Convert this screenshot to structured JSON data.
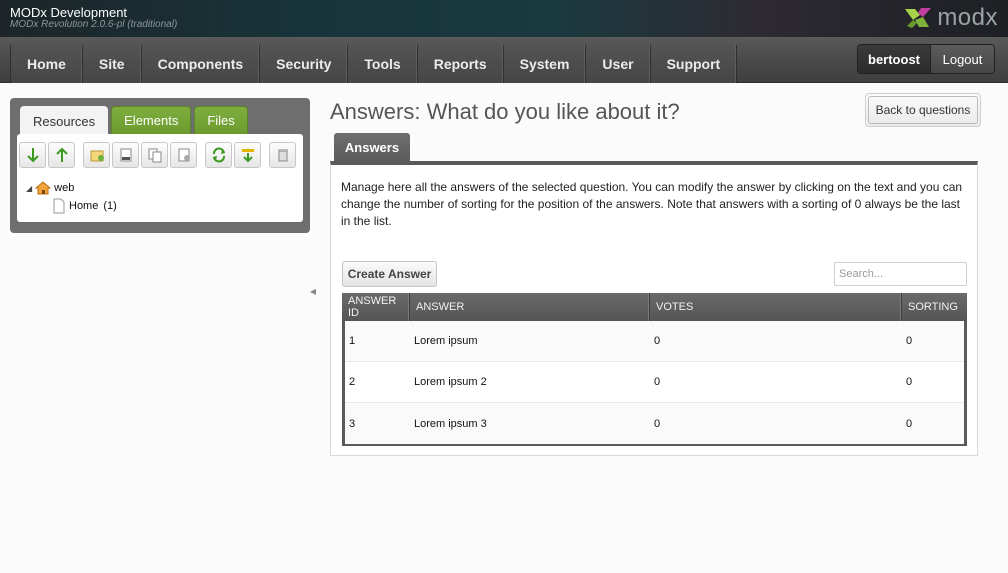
{
  "header": {
    "site_name": "MODx Development",
    "version": "MODx Revolution 2.0.6-pl (traditional)",
    "logo_text": "modx"
  },
  "nav": {
    "items": [
      "Home",
      "Site",
      "Components",
      "Security",
      "Tools",
      "Reports",
      "System",
      "User",
      "Support"
    ],
    "username": "bertoost",
    "logout": "Logout"
  },
  "sidebar": {
    "tabs": [
      "Resources",
      "Elements",
      "Files"
    ],
    "toolbar_icons": [
      "arrow-down-icon",
      "arrow-up-icon",
      "new-document-icon",
      "new-weblink-icon",
      "new-symlink-icon",
      "new-static-resource-icon",
      "refresh-icon",
      "sort-icon",
      "trash-icon"
    ],
    "tree": {
      "context": "web",
      "resource": "Home",
      "resource_id": "(1)"
    }
  },
  "main": {
    "title": "Answers: What do you like about it?",
    "back_button": "Back to questions",
    "tab": "Answers",
    "description": "Manage here all the answers of the selected question. You can modify the answer by clicking on the text and you can change the number of sorting for the position of the answers. Note that answers with a sorting of 0 always be the last in the list.",
    "create_button": "Create Answer",
    "search_placeholder": "Search...",
    "grid": {
      "columns": [
        "ANSWER ID",
        "ANSWER",
        "VOTES",
        "SORTING"
      ],
      "rows": [
        {
          "id": "1",
          "answer": "Lorem ipsum",
          "votes": "0",
          "sorting": "0"
        },
        {
          "id": "2",
          "answer": "Lorem ipsum 2",
          "votes": "0",
          "sorting": "0"
        },
        {
          "id": "3",
          "answer": "Lorem ipsum 3",
          "votes": "0",
          "sorting": "0"
        }
      ]
    }
  },
  "colors": {
    "accent_green": "#7fae3f",
    "nav_bg": "#4a4a4a"
  }
}
